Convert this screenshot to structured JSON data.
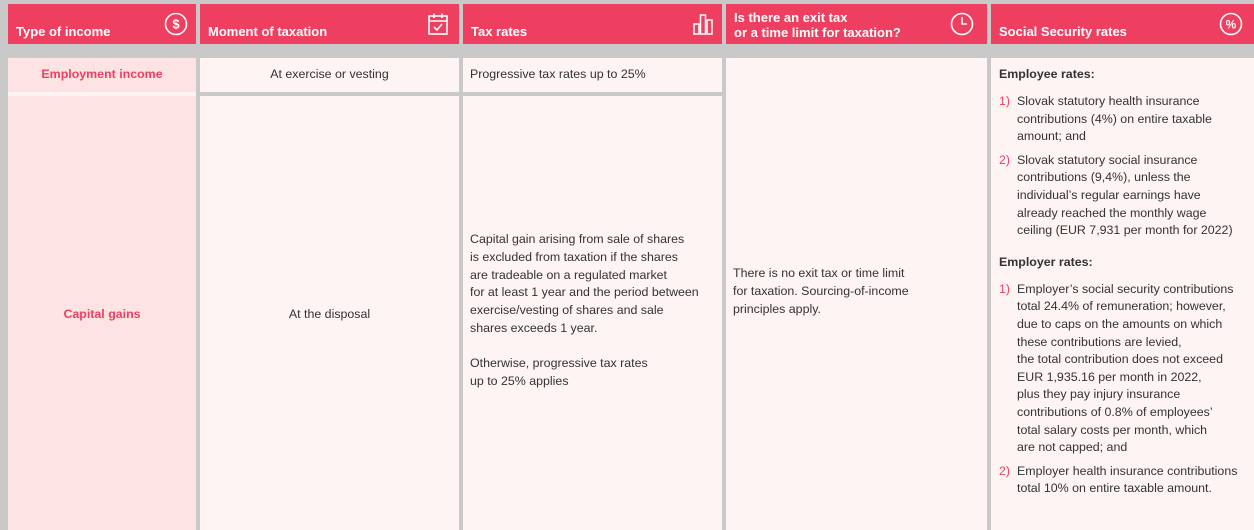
{
  "headers": {
    "type": "Type of income",
    "moment": "Moment of taxation",
    "rates": "Tax rates",
    "exit_line1": "Is there an exit tax",
    "exit_line2": "or a time limit for taxation?",
    "social": "Social Security rates"
  },
  "icons": {
    "dollar": "$",
    "percent": "%"
  },
  "rows": {
    "employment": {
      "type": "Employment income",
      "moment": "At exercise or vesting",
      "rates": "Progressive tax rates up to 25%"
    },
    "capital": {
      "type": "Capital gains",
      "moment": "At the disposal",
      "rates_lines": [
        "Capital gain arising from sale of shares",
        "is excluded from taxation if the shares",
        "are tradeable on a regulated market",
        "for at least 1 year and the period between",
        "exercise/vesting of shares and sale",
        "shares exceeds 1 year."
      ],
      "rates_otherwise_lines": [
        "Otherwise, progressive tax rates",
        "up to 25% applies"
      ]
    },
    "exit_lines": [
      "There is no exit tax or time limit",
      "for taxation. Sourcing-of-income",
      "principles apply."
    ]
  },
  "social": {
    "employee_title": "Employee rates:",
    "employee_items": [
      {
        "num": "1)",
        "lines": [
          "Slovak statutory health insurance",
          "contributions (4%) on entire taxable",
          "amount; and"
        ]
      },
      {
        "num": "2)",
        "lines": [
          "Slovak statutory social insurance",
          "contributions (9,4%), unless the",
          "individual’s regular earnings have",
          "already reached the monthly wage",
          "ceiling (EUR 7,931 per month for 2022)"
        ]
      }
    ],
    "employer_title": "Employer rates:",
    "employer_items": [
      {
        "num": "1)",
        "lines": [
          "Employer’s social security contributions",
          "total 24.4% of remuneration; however,",
          "due to caps on the amounts on which",
          "these contributions are levied,",
          "the total contribution does not exceed",
          "EUR 1,935.16 per month in 2022,",
          "plus they pay injury insurance",
          "contributions of 0.8% of employees’",
          "total salary costs per month, which",
          "are not capped; and"
        ]
      },
      {
        "num": "2)",
        "lines": [
          "Employer health insurance contributions",
          "total 10% on entire taxable amount."
        ]
      }
    ]
  }
}
